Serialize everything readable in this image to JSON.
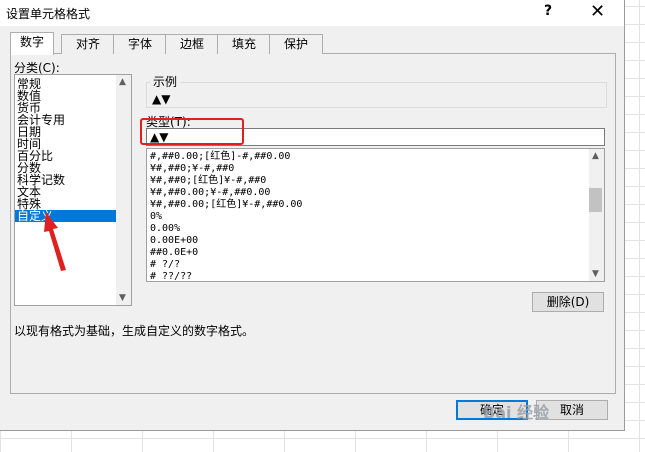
{
  "dialog": {
    "title": "设置单元格格式",
    "help": "?",
    "close": "✕"
  },
  "tabs": [
    {
      "label": "数字",
      "active": true
    },
    {
      "label": "对齐",
      "active": false
    },
    {
      "label": "字体",
      "active": false
    },
    {
      "label": "边框",
      "active": false
    },
    {
      "label": "填充",
      "active": false
    },
    {
      "label": "保护",
      "active": false
    }
  ],
  "category": {
    "label": "分类(C):",
    "items": [
      "常规",
      "数值",
      "货币",
      "会计专用",
      "日期",
      "时间",
      "百分比",
      "分数",
      "科学记数",
      "文本",
      "特殊",
      "自定义"
    ],
    "selected": "自定义"
  },
  "sample": {
    "title": "示例",
    "value": "▲▼"
  },
  "type": {
    "label": "类型(T):",
    "value": "▲▼"
  },
  "formats": [
    "#,##0.00;[红色]-#,##0.00",
    "¥#,##0;¥-#,##0",
    "¥#,##0;[红色]¥-#,##0",
    "¥#,##0.00;¥-#,##0.00",
    "¥#,##0.00;[红色]¥-#,##0.00",
    "0%",
    "0.00%",
    "0.00E+00",
    "##0.0E+0",
    "# ?/?",
    "# ??/??"
  ],
  "buttons": {
    "delete": "删除(D)",
    "ok": "确定",
    "cancel": "取消"
  },
  "description": "以现有格式为基础，生成自定义的数字格式。",
  "watermark": "Bai 经验",
  "colors": {
    "selection": "#0078d7",
    "highlight": "#e02020",
    "dialog_bg": "#f0f0f0"
  }
}
